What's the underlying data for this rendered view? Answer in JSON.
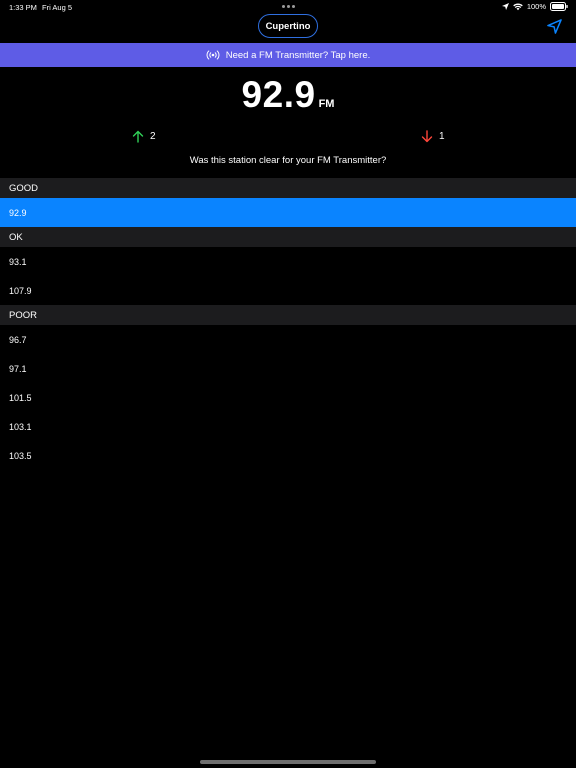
{
  "status_bar": {
    "time": "1:33 PM",
    "date": "Fri Aug 5",
    "battery": "100%"
  },
  "header": {
    "city": "Cupertino",
    "location_icon": "location-arrow-icon"
  },
  "banner": {
    "icon": "broadcast-icon",
    "text": "Need a FM Transmitter? Tap here."
  },
  "station": {
    "frequency": "92.9",
    "unit": "FM",
    "up_votes": "2",
    "down_votes": "1",
    "question": "Was this station clear for your FM Transmitter?"
  },
  "sections": [
    {
      "title": "GOOD",
      "stations": [
        "92.9"
      ]
    },
    {
      "title": "OK",
      "stations": [
        "93.1",
        "107.9"
      ]
    },
    {
      "title": "POOR",
      "stations": [
        "96.7",
        "97.1",
        "101.5",
        "103.1",
        "103.5"
      ]
    }
  ],
  "selected_station": "92.9",
  "colors": {
    "accent": "#0a84ff",
    "banner": "#5e5ce6",
    "section_bg": "#1c1c1e",
    "up": "#30d158",
    "down": "#ff453a"
  }
}
